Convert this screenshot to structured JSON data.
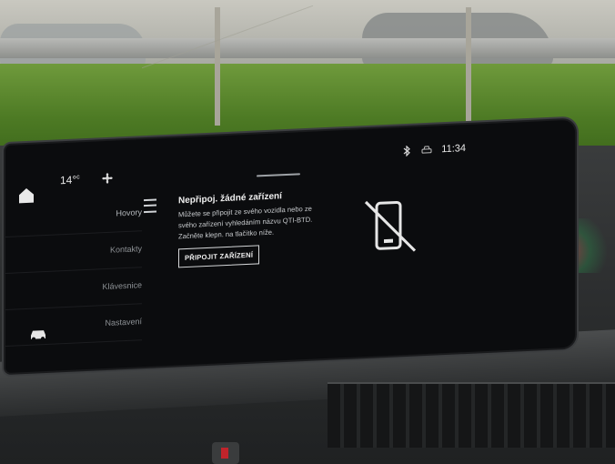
{
  "status_bar": {
    "temperature": "14°",
    "temperature_unit": "c",
    "time": "11:34",
    "icons": [
      "home-icon",
      "fan-icon",
      "bluetooth-icon",
      "car-status-icon"
    ]
  },
  "sidebar": {
    "items": [
      {
        "label": "Hovory",
        "active": true
      },
      {
        "label": "Kontakty",
        "active": false
      },
      {
        "label": "Klávesnice",
        "active": false
      },
      {
        "label": "Nastavení",
        "active": false
      }
    ]
  },
  "main": {
    "title": "Nepřipoj. žádné zařízení",
    "description": "Můžete se připojit ze svého vozidla nebo ze svého zařízení vyhledáním názvu QTI-BTD. Začněte klepn. na tlačítko níže.",
    "connect_button": "PŘIPOJIT ZAŘÍZENÍ",
    "status_icon": "phone-disconnected-icon"
  },
  "colors": {
    "screen_background": "#0b0c0e",
    "text_primary": "#f0f0f0",
    "text_secondary": "#8f9397"
  }
}
